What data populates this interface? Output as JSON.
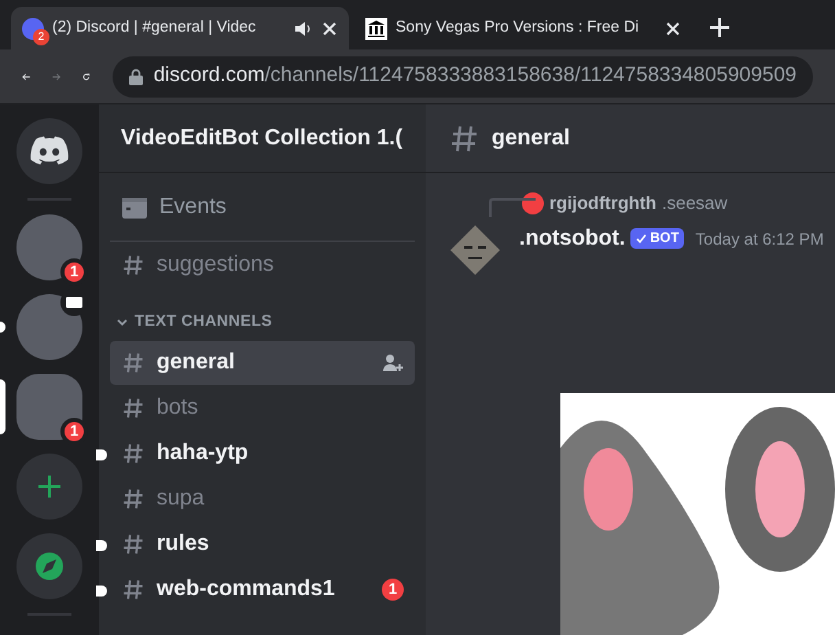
{
  "browser": {
    "tabs": [
      {
        "title": "(2) Discord | #general | Videc",
        "badge": "2",
        "audio": true,
        "selected": true
      },
      {
        "title": "Sony Vegas Pro Versions : Free Di",
        "audio": false,
        "selected": false
      }
    ],
    "url_host": "discord.com",
    "url_path": "/channels/1124758333883158638/1124758334805909509"
  },
  "servers": [
    {
      "kind": "home",
      "selected": false,
      "unread": false
    },
    {
      "kind": "server",
      "badge": "1",
      "selected": false,
      "unread": false
    },
    {
      "kind": "server",
      "selected": false,
      "unread": true,
      "streaming": true
    },
    {
      "kind": "server",
      "badge": "1",
      "selected": true,
      "unread": false
    },
    {
      "kind": "add",
      "selected": false,
      "unread": false
    },
    {
      "kind": "explore",
      "selected": false,
      "unread": false
    }
  ],
  "channel_sidebar": {
    "server_name": "VideoEditBot Collection 1.(",
    "items": [
      {
        "kind": "events",
        "label": "Events"
      },
      {
        "kind": "channel",
        "label": "suggestions",
        "selected": false,
        "unread": false
      },
      {
        "kind": "category",
        "label": "TEXT CHANNELS"
      },
      {
        "kind": "channel",
        "label": "general",
        "selected": true,
        "unread": false
      },
      {
        "kind": "channel",
        "label": "bots",
        "selected": false,
        "unread": false
      },
      {
        "kind": "channel",
        "label": "haha-ytp",
        "selected": false,
        "unread": true
      },
      {
        "kind": "channel",
        "label": "supa",
        "selected": false,
        "unread": false
      },
      {
        "kind": "channel",
        "label": "rules",
        "selected": false,
        "unread": true
      },
      {
        "kind": "channel",
        "label": "web-commands1",
        "selected": false,
        "unread": true,
        "badge": "1"
      }
    ]
  },
  "channel_header": {
    "name": "general"
  },
  "message": {
    "reply_author": "rgijodftrghth",
    "reply_text": ".seesaw",
    "author": ".notsobot.",
    "tag": "BOT",
    "time": "Today at 6:12 PM"
  }
}
